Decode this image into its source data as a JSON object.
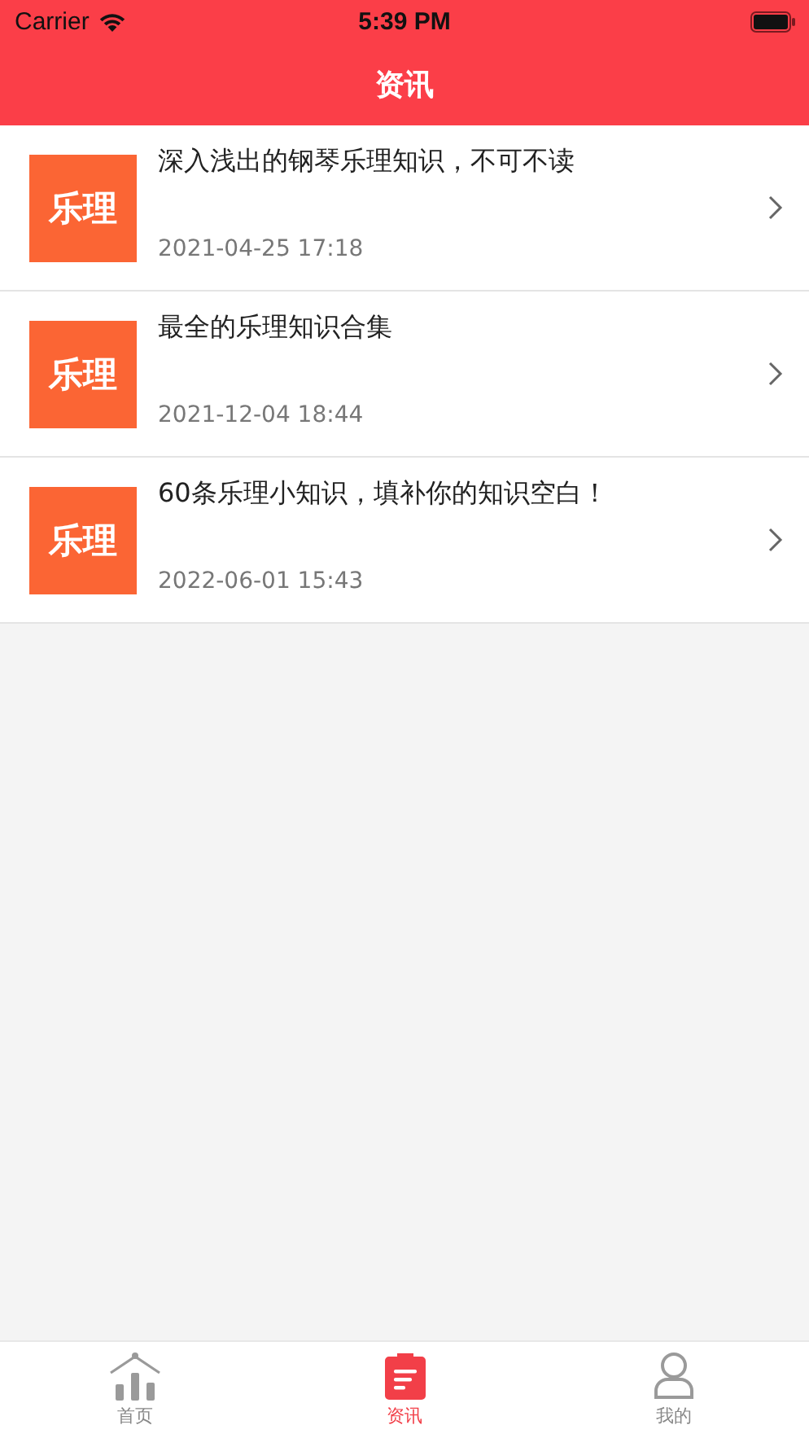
{
  "status_bar": {
    "carrier": "Carrier",
    "time": "5:39 PM"
  },
  "nav": {
    "title": "资讯"
  },
  "articles": [
    {
      "thumbnail_text": "乐理",
      "title": "深入浅出的钢琴乐理知识，不可不读",
      "date": "2021-04-25 17:18"
    },
    {
      "thumbnail_text": "乐理",
      "title": "最全的乐理知识合集",
      "date": "2021-12-04 18:44"
    },
    {
      "thumbnail_text": "乐理",
      "title": "60条乐理小知识，填补你的知识空白！",
      "date": "2022-06-01 15:43"
    }
  ],
  "tabs": [
    {
      "kind": "home",
      "label": "首页",
      "selected": false
    },
    {
      "kind": "news",
      "label": "资讯",
      "selected": true
    },
    {
      "kind": "profile",
      "label": "我的",
      "selected": false
    }
  ]
}
